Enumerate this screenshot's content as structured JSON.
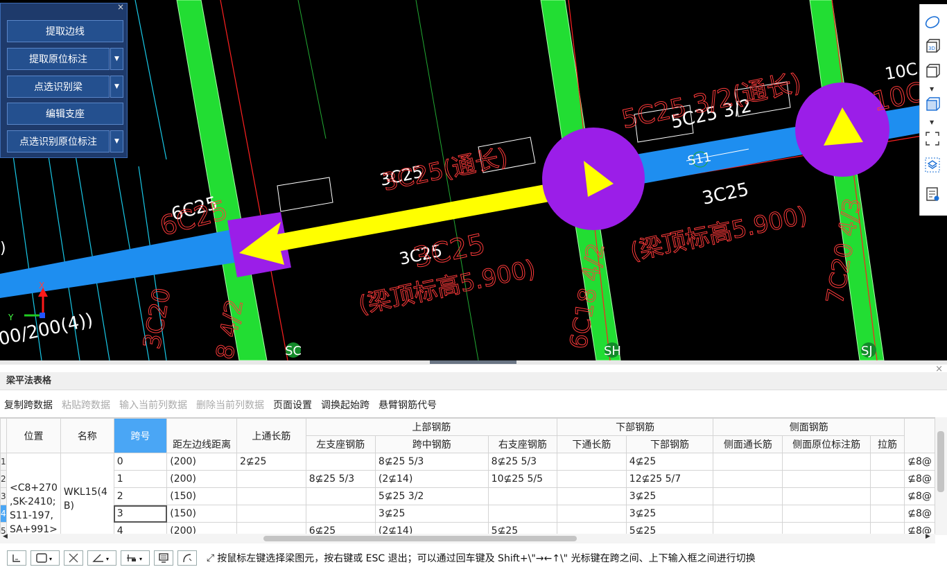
{
  "panel": {
    "close": "×",
    "buttons": [
      "提取边线",
      "提取原位标注",
      "点选识别梁",
      "编辑支座",
      "点选识别原位标注"
    ]
  },
  "canvas": {
    "labels": {
      "c6c25": "6C25",
      "c6c25_red": "6C25",
      "c3c25_top": "3C25",
      "c3c25_top_red": "3C25(通长)",
      "c3c25_mid": "3C25",
      "c3c25_mid_red": "3C25",
      "elev_left": "(梁顶标高5.900)",
      "c5c25_32": "5C25 3/2",
      "c5c25_red": "5C25 3/2(通长)",
      "s11": "S11",
      "c3c25_right": "3C25",
      "elev_right": "(梁顶标高5.900)",
      "c10c": "10C",
      "c10c_red": "10C",
      "beam_dim": "00/200(4))",
      "c3c20": "3C20",
      "c84_2": "8 4/2",
      "c6c18": "6C18 4/2",
      "c7c20": "7C20 4/3",
      "axis_sc": "SC",
      "axis_sh": "SH",
      "axis_sj": "SJ",
      "paren": ")",
      "axis_x": "X",
      "axis_y": "Y"
    }
  },
  "right_tools": [
    "orbit-icon",
    "3d-view-icon",
    "box-view-icon",
    "solid-box-icon",
    "fullscreen-icon",
    "layer-icon",
    "properties-icon"
  ],
  "bottom": {
    "title": "梁平法表格",
    "close": "×",
    "toolbar": [
      {
        "label": "复制跨数据",
        "enabled": true
      },
      {
        "label": "粘贴跨数据",
        "enabled": false
      },
      {
        "label": "输入当前列数据",
        "enabled": false
      },
      {
        "label": "删除当前列数据",
        "enabled": false
      },
      {
        "label": "页面设置",
        "enabled": true
      },
      {
        "label": "调换起始跨",
        "enabled": true
      },
      {
        "label": "悬臂钢筋代号",
        "enabled": true
      }
    ],
    "table": {
      "h_position": "位置",
      "h_name": "名称",
      "h_span": "跨号",
      "h_dist": "距左边线距离",
      "h_top_through": "上通长筋",
      "h_top": "上部钢筋",
      "h_left_support": "左支座钢筋",
      "h_mid": "跨中钢筋",
      "h_right_support": "右支座钢筋",
      "h_bottom": "下部钢筋",
      "h_bottom_through": "下通长筋",
      "h_bottom_bars": "下部钢筋",
      "h_side": "侧面钢筋",
      "h_side_through": "侧面通长筋",
      "h_side_orig": "侧面原位标注筋",
      "h_tie": "拉筋",
      "position_value": "<C8+270\n,SK-2410;\nS11-197,\nSA+991>",
      "name_value": "WKL15(4\nB)",
      "rows": [
        {
          "n": "1",
          "span": "0",
          "dist": "(200)",
          "top_through": "2⊈25",
          "left": "",
          "mid": "8⊈25 5/3",
          "right": "8⊈25 5/3",
          "bt": "",
          "bottom": "4⊈25",
          "st": "",
          "so": "",
          "tie": "",
          "last": "⊈8@"
        },
        {
          "n": "2",
          "span": "1",
          "dist": "(200)",
          "top_through": "",
          "left": "8⊈25 5/3",
          "mid": "(2⊈14)",
          "right": "10⊈25 5/5",
          "bt": "",
          "bottom": "12⊈25 5/7",
          "st": "",
          "so": "",
          "tie": "",
          "last": "⊈8@"
        },
        {
          "n": "3",
          "span": "2",
          "dist": "(150)",
          "top_through": "",
          "left": "",
          "mid": "5⊈25 3/2",
          "right": "",
          "bt": "",
          "bottom": "3⊈25",
          "st": "",
          "so": "",
          "tie": "",
          "last": "⊈8@"
        },
        {
          "n": "4",
          "span": "3",
          "dist": "(150)",
          "top_through": "",
          "left": "",
          "mid": "3⊈25",
          "right": "",
          "bt": "",
          "bottom": "3⊈25",
          "st": "",
          "so": "",
          "tie": "",
          "last": "⊈8@"
        },
        {
          "n": "5",
          "span": "4",
          "dist": "(200)",
          "top_through": "",
          "left": "6⊈25",
          "mid": "(2⊈14)",
          "right": "5⊈25",
          "bt": "",
          "bottom": "5⊈25",
          "st": "",
          "so": "",
          "tie": "",
          "last": "⊈8@"
        }
      ]
    },
    "status_message": "按鼠标左键选择梁图元，按右键或 ESC 退出；可以通过回车键及 Shift+\\\"→←↑\\\" 光标键在跨之间、上下输入框之间进行切换"
  },
  "colors": {
    "canvas_bg": "#000000",
    "column_green": "#22dd33",
    "beam_blue": "#1e8ef0",
    "support_purple": "#9b1ee8",
    "arrow_yellow": "#ffff00",
    "annotation_red": "#ff3a3a",
    "header_selected": "#4aa6f5"
  }
}
